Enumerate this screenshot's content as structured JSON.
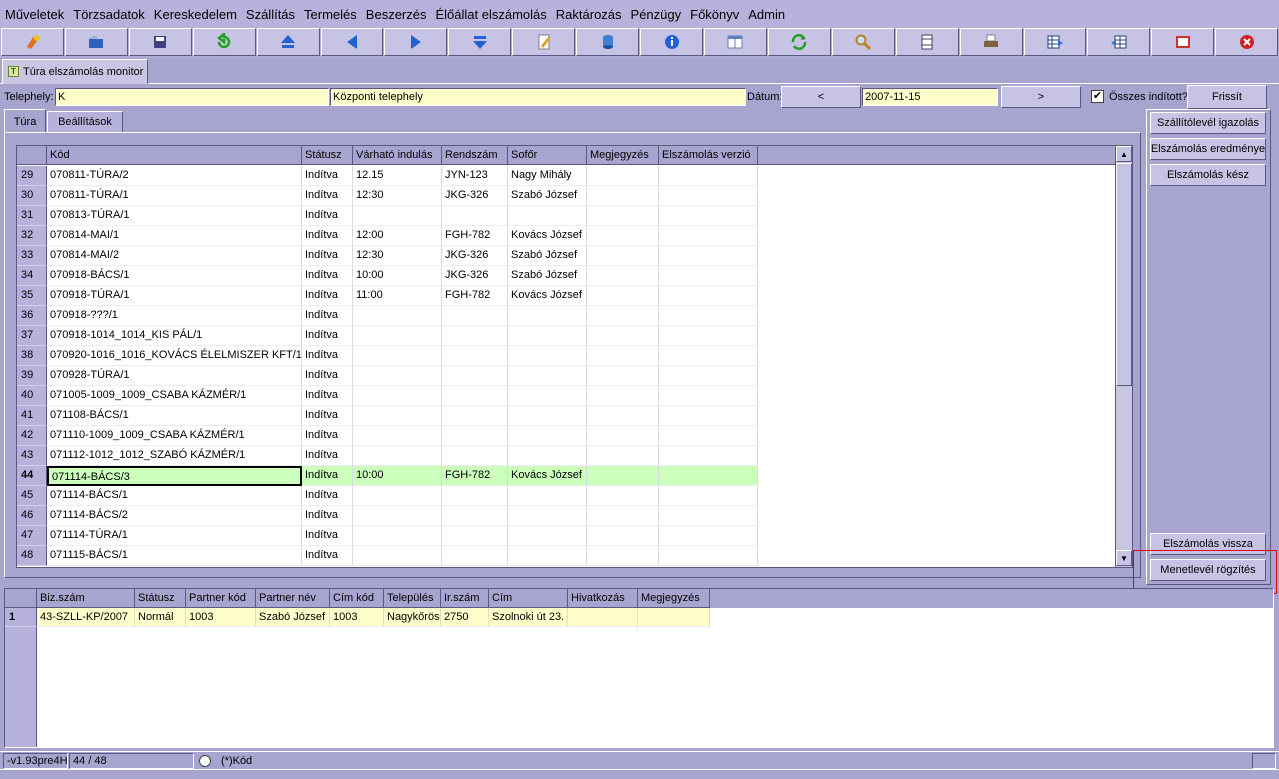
{
  "menu": [
    "Műveletek",
    "Törzsadatok",
    "Kereskedelem",
    "Szállítás",
    "Termelés",
    "Beszerzés",
    "Élőállat elszámolás",
    "Raktározás",
    "Pénzügy",
    "Főkönyv",
    "Admin"
  ],
  "toolbar": [
    {
      "name": "run-icon",
      "color": "#e07020"
    },
    {
      "name": "open-icon",
      "color": "#3060c0"
    },
    {
      "name": "save-icon",
      "color": "#404080"
    },
    {
      "name": "undo-icon",
      "color": "#20a020"
    },
    {
      "name": "first-icon",
      "color": "#2060d0"
    },
    {
      "name": "prev-icon",
      "color": "#2060d0"
    },
    {
      "name": "next-icon",
      "color": "#2060d0"
    },
    {
      "name": "last-icon",
      "color": "#2060d0"
    },
    {
      "name": "edit-icon",
      "color": "#e0a020"
    },
    {
      "name": "database-icon",
      "color": "#4080d0"
    },
    {
      "name": "info-icon",
      "color": "#2060d0"
    },
    {
      "name": "form-icon",
      "color": "#6080c0"
    },
    {
      "name": "refresh-icon",
      "color": "#20a020"
    },
    {
      "name": "search-icon",
      "color": "#c08020"
    },
    {
      "name": "column-icon",
      "color": "#404060"
    },
    {
      "name": "print-icon",
      "color": "#806040"
    },
    {
      "name": "grid-export-icon",
      "color": "#204080"
    },
    {
      "name": "grid-import-icon",
      "color": "#204080"
    },
    {
      "name": "fullscreen-icon",
      "color": "#d03030"
    },
    {
      "name": "close-icon",
      "color": "#d02020"
    }
  ],
  "doc_tab": {
    "label": "Túra elszámolás monitor"
  },
  "filter": {
    "telephely_label": "Telephely:",
    "telephely_code": "K",
    "telephely_name": "Központi telephely",
    "datum_label": "Dátum:",
    "prev": "<",
    "date": "2007-11-15",
    "next": ">",
    "checkbox_mark": "✔",
    "osszes_label": "Összes indított?",
    "frissit": "Frissít"
  },
  "tabs": [
    "Túra",
    "Beállítások"
  ],
  "main_grid": {
    "columns": [
      "Kód",
      "Státusz",
      "Várható indulás",
      "Rendszám",
      "Sofőr",
      "Megjegyzés",
      "Elszámolás verzió"
    ],
    "rows": [
      {
        "n": "29",
        "kod": "070811-TÚRA/2",
        "statusz": "Indítva",
        "indulas": "12.15",
        "rendszam": "JYN-123",
        "sofor": "Nagy Mihály"
      },
      {
        "n": "30",
        "kod": "070811-TÚRA/1",
        "statusz": "Indítva",
        "indulas": "12:30",
        "rendszam": "JKG-326",
        "sofor": "Szabó József"
      },
      {
        "n": "31",
        "kod": "070813-TÚRA/1",
        "statusz": "Indítva",
        "indulas": "",
        "rendszam": "",
        "sofor": ""
      },
      {
        "n": "32",
        "kod": "070814-MAI/1",
        "statusz": "Indítva",
        "indulas": "12:00",
        "rendszam": "FGH-782",
        "sofor": "Kovács József"
      },
      {
        "n": "33",
        "kod": "070814-MAI/2",
        "statusz": "Indítva",
        "indulas": "12:30",
        "rendszam": "JKG-326",
        "sofor": "Szabó József"
      },
      {
        "n": "34",
        "kod": "070918-BÁCS/1",
        "statusz": "Indítva",
        "indulas": "10:00",
        "rendszam": "JKG-326",
        "sofor": "Szabó József"
      },
      {
        "n": "35",
        "kod": "070918-TÚRA/1",
        "statusz": "Indítva",
        "indulas": "11:00",
        "rendszam": "FGH-782",
        "sofor": "Kovács József"
      },
      {
        "n": "36",
        "kod": "070918-???/1",
        "statusz": "Indítva",
        "indulas": "",
        "rendszam": "",
        "sofor": ""
      },
      {
        "n": "37",
        "kod": "070918-1014_1014_KIS PÁL/1",
        "statusz": "Indítva",
        "indulas": "",
        "rendszam": "",
        "sofor": ""
      },
      {
        "n": "38",
        "kod": "070920-1016_1016_KOVÁCS ÉLELMISZER KFT/1",
        "statusz": "Indítva",
        "indulas": "",
        "rendszam": "",
        "sofor": ""
      },
      {
        "n": "39",
        "kod": "070928-TÚRA/1",
        "statusz": "Indítva",
        "indulas": "",
        "rendszam": "",
        "sofor": ""
      },
      {
        "n": "40",
        "kod": "071005-1009_1009_CSABA KÁZMÉR/1",
        "statusz": "Indítva",
        "indulas": "",
        "rendszam": "",
        "sofor": ""
      },
      {
        "n": "41",
        "kod": "071108-BÁCS/1",
        "statusz": "Indítva",
        "indulas": "",
        "rendszam": "",
        "sofor": ""
      },
      {
        "n": "42",
        "kod": "071110-1009_1009_CSABA KÁZMÉR/1",
        "statusz": "Indítva",
        "indulas": "",
        "rendszam": "",
        "sofor": ""
      },
      {
        "n": "43",
        "kod": "071112-1012_1012_SZABÓ KÁZMÉR/1",
        "statusz": "Indítva",
        "indulas": "",
        "rendszam": "",
        "sofor": ""
      },
      {
        "n": "44",
        "kod": "071114-BÁCS/3",
        "statusz": "Indítva",
        "indulas": "10:00",
        "rendszam": "FGH-782",
        "sofor": "Kovács József",
        "selected": true
      },
      {
        "n": "45",
        "kod": "071114-BÁCS/1",
        "statusz": "Indítva",
        "indulas": "",
        "rendszam": "",
        "sofor": ""
      },
      {
        "n": "46",
        "kod": "071114-BÁCS/2",
        "statusz": "Indítva",
        "indulas": "",
        "rendszam": "",
        "sofor": ""
      },
      {
        "n": "47",
        "kod": "071114-TÚRA/1",
        "statusz": "Indítva",
        "indulas": "",
        "rendszam": "",
        "sofor": ""
      },
      {
        "n": "48",
        "kod": "071115-BÁCS/1",
        "statusz": "Indítva",
        "indulas": "",
        "rendszam": "",
        "sofor": ""
      }
    ]
  },
  "right_buttons": {
    "szallitolevel": "Szállítólevél igazolás",
    "eredmeny": "Elszámolás eredménye",
    "kesz": "Elszámolás kész",
    "vissza": "Elszámolás vissza",
    "menetlevel": "Menetlevél rögzítés"
  },
  "detail_grid": {
    "columns": [
      "Biz.szám",
      "Státusz",
      "Partner kód",
      "Partner név",
      "Cím kód",
      "Település",
      "Ir.szám",
      "Cím",
      "Hivatkozás",
      "Megjegyzés"
    ],
    "rows": [
      {
        "n": "1",
        "cells": [
          "43-SZLL-KP/2007",
          "Normál",
          "1003",
          "Szabó József",
          "1003",
          "Nagykőrös",
          "2750",
          "Szolnoki út 23.",
          "",
          ""
        ]
      }
    ]
  },
  "status": {
    "version": "-v1.93pre4H",
    "position": "44 / 48",
    "filter": "(*)Kód"
  }
}
